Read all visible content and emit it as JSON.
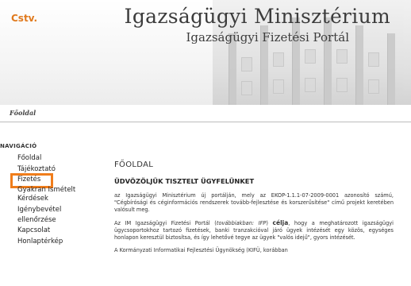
{
  "header": {
    "logo": "Cstv.",
    "title": "Igazságügyi Minisztérium",
    "subtitle": "Igazságügyi Fizetési Portál"
  },
  "breadcrumb": "Főoldal",
  "nav": {
    "heading": "NAVIGÁCIÓ",
    "items": [
      {
        "label": "Főoldal"
      },
      {
        "label": "Tájékoztató"
      },
      {
        "label": "Fizetés",
        "active": true
      },
      {
        "label": "Gyakran Ismételt Kérdések"
      },
      {
        "label": "Igénybevétel ellenőrzése"
      },
      {
        "label": "Kapcsolat"
      },
      {
        "label": "Honlaptérkép"
      }
    ],
    "highlight_color": "#f07d1b"
  },
  "main": {
    "page_title": "FŐOLDAL",
    "greeting": "ÜDVÖZÖLJÜK TISZTELT ÜGYFELÜNKET",
    "para1": "az Igazságügyi Minisztérium új portálján, mely az EKOP-1.1.1-07-2009-0001 azonosító számú, \"Cégbírósági és céginformációs rendszerek tovább-fejlesztése és korszerűsítése\" című projekt keretében valósult meg.",
    "para2_a": "Az IM Igazságügyi Fizetési Portál (",
    "para2_italic": "továbbiakban: IFP",
    "para2_b": ") ",
    "para2_bold": "célja",
    "para2_c": ", hogy a meghatározott igazságügyi ügycsoportokhoz tartozó fizetések, banki tranzakcióval járó ügyek intézését egy közös, egységes honlapon keresztül biztosítsa, és így lehetővé tegye az ügyek \"valós idejű\", gyors intézését.",
    "para3": "A Kormányzati Informatikai Fejlesztési Ügynökség (KIFÜ, korábban"
  },
  "colors": {
    "accent": "#f07d1b",
    "logo": "#e07a1e",
    "title": "#3c3c3c"
  }
}
